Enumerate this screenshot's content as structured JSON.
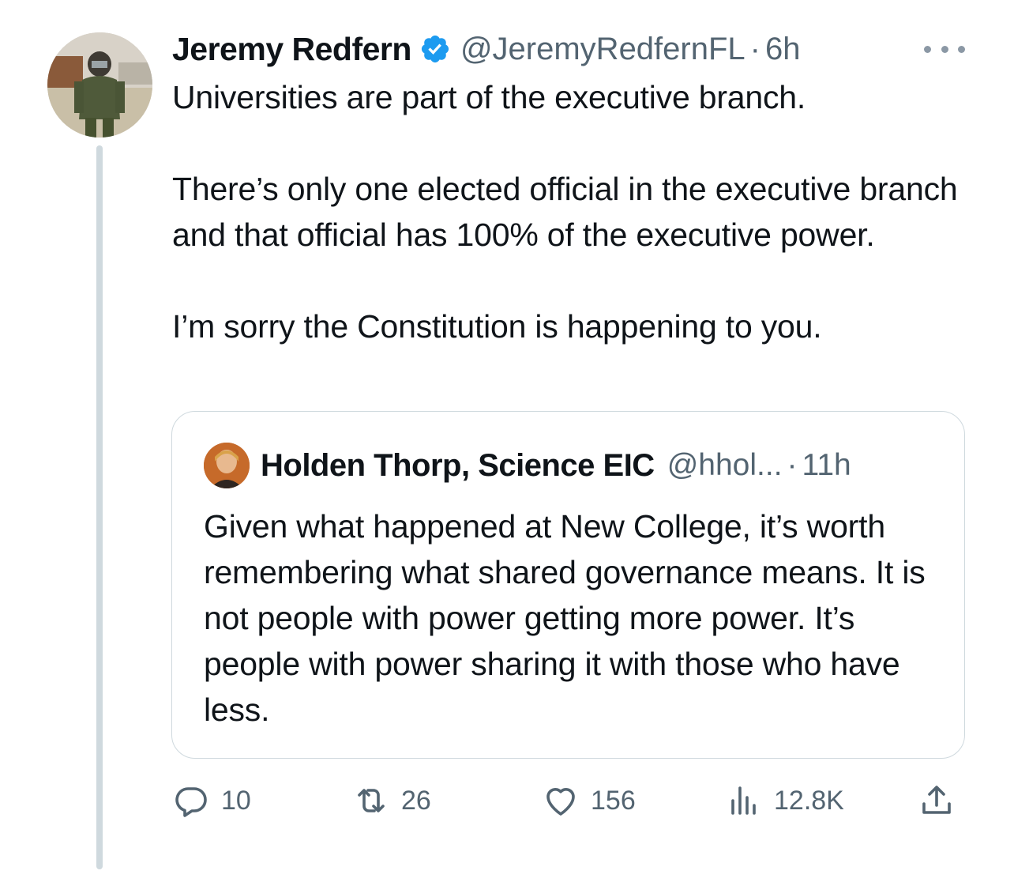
{
  "tweet": {
    "author_name": "Jeremy Redfern",
    "handle": "@JeremyRedfernFL",
    "separator": "·",
    "time": "6h",
    "paragraphs": [
      "Universities are part of the executive branch.",
      "There’s only one elected official in the executive branch and that official has 100% of the executive power.",
      "I’m sorry the Constitution is happening to you."
    ]
  },
  "quote": {
    "author_name": "Holden Thorp, Science EIC",
    "handle": "@hhol...",
    "separator": "·",
    "time": "11h",
    "text": "Given what happened at New College, it’s worth remembering what shared governance means. It is not people with power getting more power. It’s people with power sharing it with those who have less."
  },
  "actions": {
    "replies": "10",
    "retweets": "26",
    "likes": "156",
    "views": "12.8K"
  },
  "icons": {
    "verified": "verified-badge-icon",
    "more": "more-options-icon",
    "reply": "reply-icon",
    "retweet": "retweet-icon",
    "like": "heart-icon",
    "views": "views-icon",
    "share": "share-icon"
  },
  "colors": {
    "verified_blue": "#1d9bf0",
    "text": "#0f1419",
    "secondary": "#536471",
    "border": "#cfd9de"
  }
}
